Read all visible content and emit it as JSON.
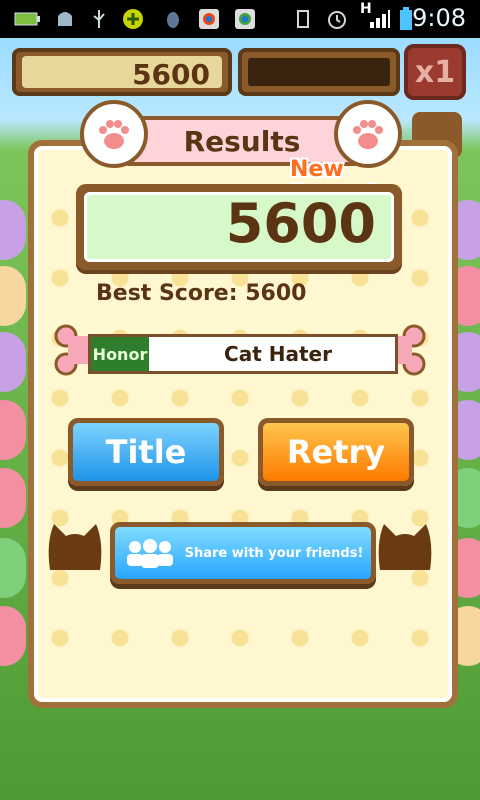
{
  "status_bar": {
    "time": "9:08",
    "network_label": "H",
    "icons": [
      "battery-level-icon",
      "android-icon",
      "usb-icon",
      "plus-icon",
      "bug-icon",
      "chrome-app-icon",
      "chrome-app-icon",
      "vibrate-icon",
      "alarm-icon",
      "signal-icon",
      "battery-icon"
    ]
  },
  "hud": {
    "score": "5600",
    "multiplier": "x1"
  },
  "results": {
    "title": "Results",
    "new_record_label": "New Record",
    "score": "5600",
    "best_score_label": "Best Score:",
    "best_score_value": "5600",
    "honor_tag": "Honor",
    "honor_value": "Cat Hater",
    "title_button": "Title",
    "retry_button": "Retry",
    "share_button": "Share with your friends!"
  },
  "colors": {
    "panel_bg": "#fff7cf",
    "wood": "#8b5a2b",
    "title_button": "#1f93e8",
    "retry_button": "#ff7a00",
    "share_button": "#2aa5ff",
    "new_record": "#ff6d1f"
  }
}
